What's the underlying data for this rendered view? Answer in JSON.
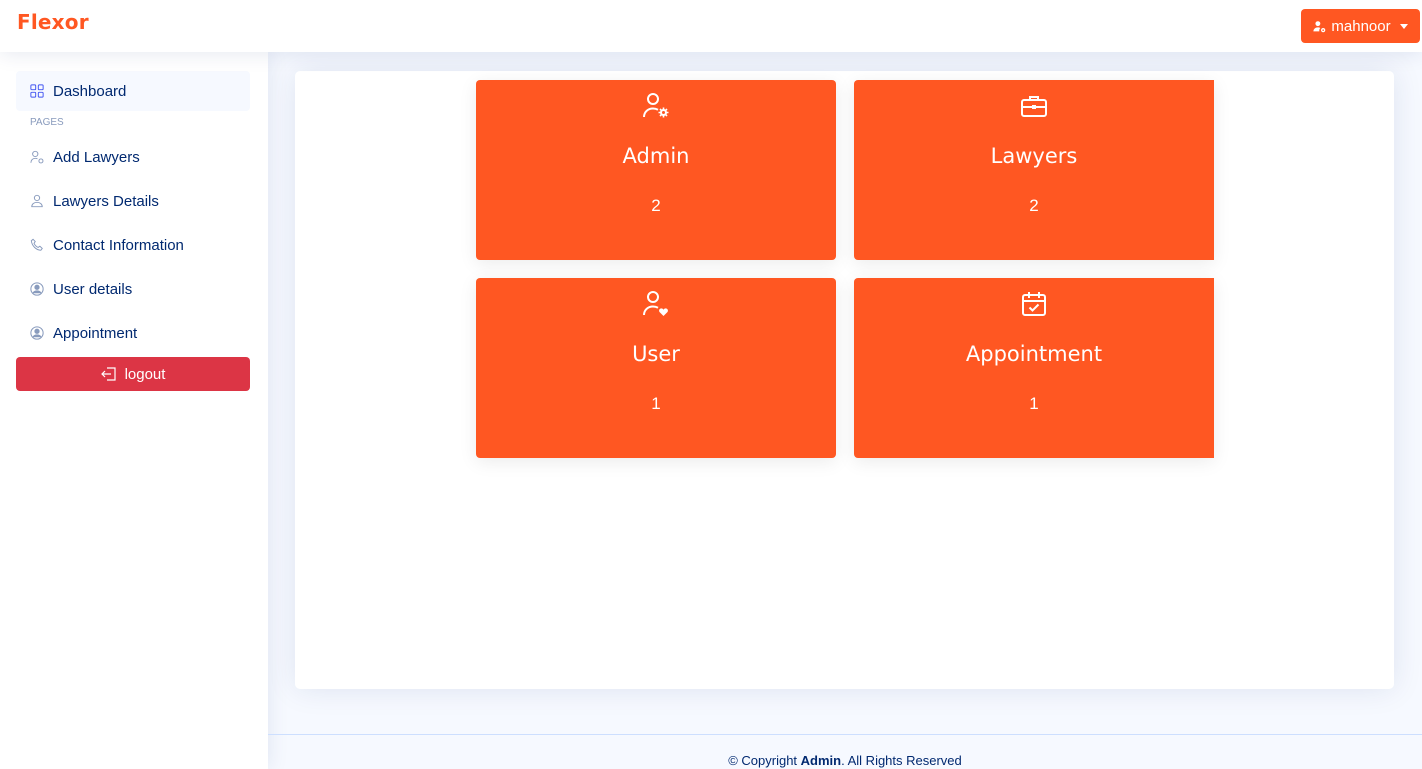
{
  "header": {
    "logo": "Flexor",
    "user_name": "mahnoor",
    "accent_color": "#ff5722"
  },
  "sidebar": {
    "items": [
      {
        "label": "Dashboard",
        "icon": "grid-icon"
      },
      {
        "label": "Add Lawyers",
        "icon": "person-gear-icon"
      },
      {
        "label": "Lawyers Details",
        "icon": "person-icon"
      },
      {
        "label": "Contact Information",
        "icon": "phone-icon"
      },
      {
        "label": "User details",
        "icon": "person-circle-icon"
      },
      {
        "label": "Appointment",
        "icon": "person-circle-icon"
      }
    ],
    "pages_heading": "PAGES",
    "logout_label": "logout",
    "logout_color": "#dc3545"
  },
  "stats": [
    {
      "title": "Admin",
      "count": "2",
      "icon": "person-gear-icon"
    },
    {
      "title": "Lawyers",
      "count": "2",
      "icon": "briefcase-icon"
    },
    {
      "title": "User",
      "count": "1",
      "icon": "person-heart-icon"
    },
    {
      "title": "Appointment",
      "count": "1",
      "icon": "calendar-check-icon"
    }
  ],
  "footer": {
    "prefix": "© Copyright ",
    "brand": "Admin",
    "suffix": ". All Rights Reserved"
  }
}
